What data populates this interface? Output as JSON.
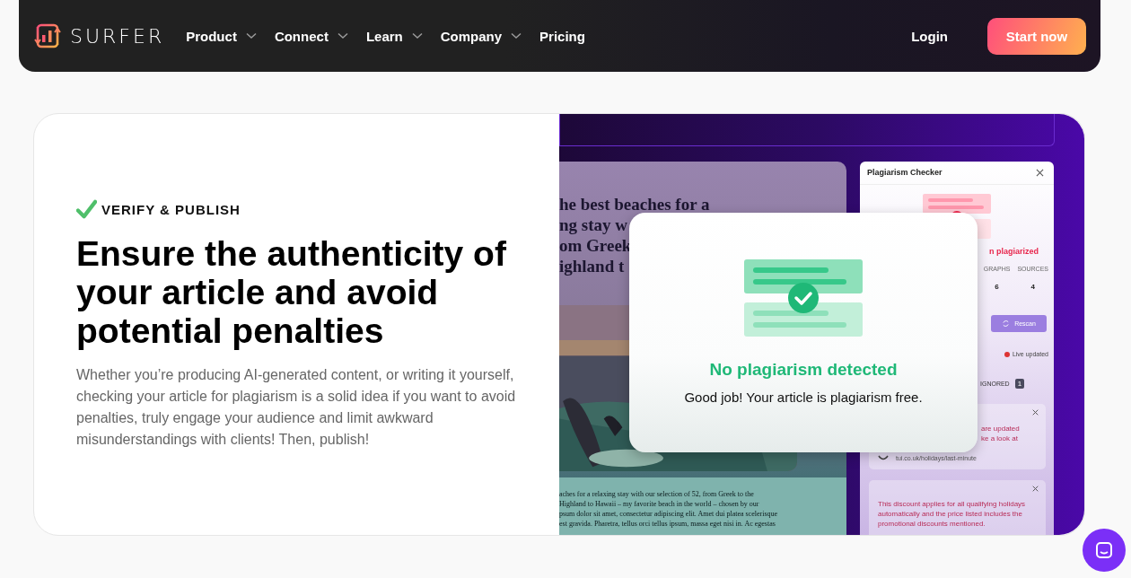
{
  "nav": {
    "logo": "SURFER",
    "items": [
      {
        "label": "Product",
        "has_menu": true
      },
      {
        "label": "Connect",
        "has_menu": true
      },
      {
        "label": "Learn",
        "has_menu": true
      },
      {
        "label": "Company",
        "has_menu": true
      },
      {
        "label": "Pricing",
        "has_menu": false
      }
    ],
    "login": "Login",
    "cta": "Start now"
  },
  "hero": {
    "eyebrow": "VERIFY & PUBLISH",
    "title": "Ensure the authenticity of your article and avoid potential penalties",
    "body": "Whether you’re producing AI-generated content, or writing it yourself, checking your article for plagiarism is a solid idea if you want to avoid penalties, truly engage your audience and limit awkward misunderstandings with clients! Then, publish!"
  },
  "illustration": {
    "article": {
      "title_lines": [
        "he best beaches for a",
        "ng stay w",
        "om Greek",
        "ighland t"
      ],
      "body_lines": [
        "aches for a relaxing stay with our selection of 52, from Greek to the",
        "Highland to Hawaii – my favorite beach in the world – chosen by our",
        "psum dolor sit amet, consectetur adipiscing elit. Amet dui platea scelerisque",
        " est gravida. Pharetra, tellus orci tellus ipsum, massa eget nisi in. Ac egestas"
      ]
    },
    "checker": {
      "title": "Plagiarism Checker",
      "status": "n plagiarized",
      "columns": [
        "GRAPHS",
        "SOURCES"
      ],
      "values": [
        "6",
        "4"
      ],
      "rescan": "Rescan",
      "live": "Live updated",
      "ignored": "IGNORED",
      "ignored_count": "1",
      "cards": [
        {
          "lines": [
            "are updated",
            "ke a look at"
          ],
          "link": "tui.co.uk/holidays/last-minute"
        },
        {
          "lines": [
            "This discount applies for all qualifying holidays",
            "automatically and the price listed includes the",
            "promotional discounts mentioned."
          ]
        }
      ]
    },
    "popup": {
      "title": "No plagiarism detected",
      "message": "Good job! Your article is plagiarism free."
    }
  }
}
